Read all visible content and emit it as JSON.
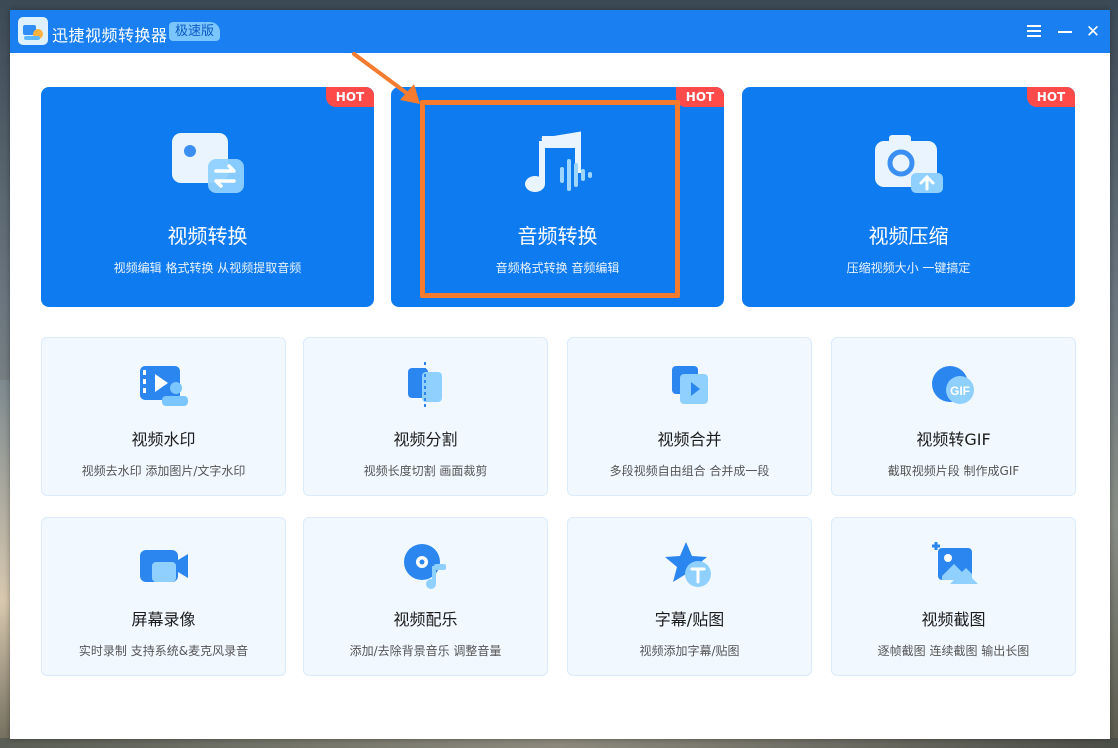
{
  "window": {
    "title": "迅捷视频转换器",
    "badge": "极速版",
    "controls": {
      "menu_icon": "menu-icon",
      "minimize_icon": "minimize-icon",
      "close_icon": "close-icon"
    }
  },
  "main_features": [
    {
      "title": "视频转换",
      "subtitle": "视频编辑 格式转换 从视频提取音频",
      "badge": "HOT",
      "icon": "video-convert-icon"
    },
    {
      "title": "音频转换",
      "subtitle": "音频格式转换 音频编辑",
      "badge": "HOT",
      "icon": "audio-convert-icon",
      "highlighted": true
    },
    {
      "title": "视频压缩",
      "subtitle": "压缩视频大小 一键搞定",
      "badge": "HOT",
      "icon": "video-compress-icon"
    }
  ],
  "tools": [
    {
      "title": "视频水印",
      "subtitle": "视频去水印 添加图片/文字水印",
      "icon": "watermark-icon"
    },
    {
      "title": "视频分割",
      "subtitle": "视频长度切割 画面裁剪",
      "icon": "split-icon"
    },
    {
      "title": "视频合并",
      "subtitle": "多段视频自由组合 合并成一段",
      "icon": "merge-icon"
    },
    {
      "title": "视频转GIF",
      "subtitle": "截取视频片段 制作成GIF",
      "icon": "gif-icon"
    },
    {
      "title": "屏幕录像",
      "subtitle": "实时录制 支持系统&麦克风录音",
      "icon": "screen-record-icon"
    },
    {
      "title": "视频配乐",
      "subtitle": "添加/去除背景音乐 调整音量",
      "icon": "music-icon"
    },
    {
      "title": "字幕/贴图",
      "subtitle": "视频添加字幕/贴图",
      "icon": "subtitle-icon"
    },
    {
      "title": "视频截图",
      "subtitle": "逐帧截图 连续截图 输出长图",
      "icon": "screenshot-icon"
    }
  ],
  "colors": {
    "titlebar": "#1a7ff0",
    "card": "#0f7bf0",
    "hot": "#ff4a4a",
    "highlight": "#f57b2e"
  }
}
